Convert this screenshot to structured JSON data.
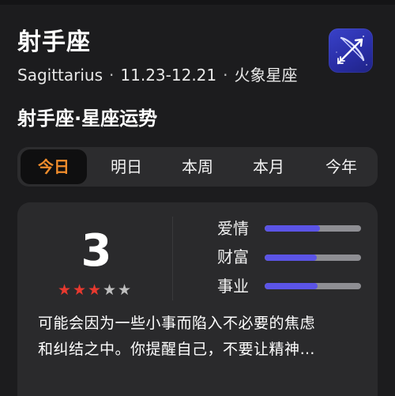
{
  "header": {
    "sign_name": "射手座",
    "english_name": "Sagittarius",
    "date_range": "11.23-12.21",
    "element": "火象星座",
    "logo_icon": "sagittarius-bow-arrow-icon"
  },
  "section": {
    "title": "射手座·星座运势"
  },
  "tabs": [
    {
      "label": "今日",
      "active": true
    },
    {
      "label": "明日",
      "active": false
    },
    {
      "label": "本周",
      "active": false
    },
    {
      "label": "本月",
      "active": false
    },
    {
      "label": "今年",
      "active": false
    }
  ],
  "fortune": {
    "score": "3",
    "stars": {
      "filled": 3,
      "total": 5
    },
    "metrics": [
      {
        "label": "爱情",
        "level": 0.57
      },
      {
        "label": "财富",
        "level": 0.54
      },
      {
        "label": "事业",
        "level": 0.55
      }
    ],
    "description_lines": [
      "可能会因为一些小事而陷入不必要的焦虑",
      "和纠结之中。你提醒自己，不要让精神…"
    ]
  },
  "colors": {
    "background": "#1c1c1e",
    "card": "#2a2a2c",
    "active_tab_text": "#f08c2c",
    "star_filled": "#e8392f",
    "star_empty": "#bfbfbf",
    "bar_fill": "#5b54e6",
    "bar_track": "#8e8e93",
    "logo": "#2a2fa8"
  }
}
